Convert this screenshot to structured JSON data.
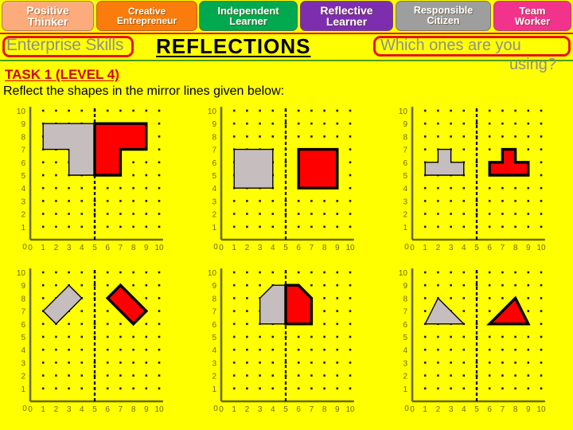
{
  "header": {
    "tabs": [
      {
        "id": "positive-thinker",
        "line1": "Positive",
        "line2": "Thinker",
        "color": "#FCAB7C"
      },
      {
        "id": "creative-entrepreneur",
        "line1": "Creative",
        "line2": "Entrepreneur",
        "color": "#F97C0C"
      },
      {
        "id": "independent-learner",
        "line1": "Independent",
        "line2": "Learner",
        "color": "#00A94F"
      },
      {
        "id": "reflective-learner",
        "line1": "Reflective",
        "line2": "Learner",
        "color": "#7D2EAF"
      },
      {
        "id": "responsible-citizen",
        "line1": "Responsible",
        "line2": "Citizen",
        "color": "#9E9E9E"
      },
      {
        "id": "team-worker",
        "line1": "Team",
        "line2": "Worker",
        "color": "#F2338C"
      }
    ]
  },
  "title": {
    "enterprise_skills": "Enterprise Skills",
    "main": "REFLECTIONS",
    "prompt_line1": "Which ones are you",
    "prompt_line2": "using?"
  },
  "task": {
    "heading": "TASK 1 (LEVEL 4)",
    "instruction": "Reflect the shapes in the mirror lines given below:"
  },
  "colors": {
    "page_background": "#FFFF00",
    "shape_original": "#C6BEBE",
    "shape_reflection": "#FF0000",
    "axis": "#6B6B00",
    "mirror_line": "#000000",
    "title_red": "#E81313",
    "rule_green": "#4E9A06"
  },
  "grid_common": {
    "x_ticks": [
      "0",
      "1",
      "2",
      "3",
      "4",
      "5",
      "6",
      "7",
      "8",
      "9",
      "10"
    ],
    "y_ticks": [
      "0",
      "1",
      "2",
      "3",
      "4",
      "5",
      "6",
      "7",
      "8",
      "9",
      "10"
    ],
    "x_range": [
      0,
      10
    ],
    "y_range": [
      0,
      10
    ],
    "mirror_line_x": 5,
    "dots": true
  },
  "chart_data": [
    {
      "type": "scatter",
      "id": "grid-1",
      "title": "",
      "xlabel": "",
      "ylabel": "",
      "xlim": [
        0,
        10
      ],
      "ylim": [
        0,
        10
      ],
      "mirror_x": 5,
      "shapes": [
        {
          "name": "original-L-shape",
          "fill": "#C6BEBE",
          "points": [
            [
              1,
              9
            ],
            [
              5,
              9
            ],
            [
              5,
              5
            ],
            [
              3,
              5
            ],
            [
              3,
              7
            ],
            [
              1,
              7
            ]
          ]
        },
        {
          "name": "reflected-L-shape",
          "fill": "#FF0000",
          "points": [
            [
              9,
              9
            ],
            [
              5,
              9
            ],
            [
              5,
              5
            ],
            [
              7,
              5
            ],
            [
              7,
              7
            ],
            [
              9,
              7
            ]
          ]
        }
      ]
    },
    {
      "type": "scatter",
      "id": "grid-2",
      "title": "",
      "xlabel": "",
      "ylabel": "",
      "xlim": [
        0,
        10
      ],
      "ylim": [
        0,
        10
      ],
      "mirror_x": 5,
      "shapes": [
        {
          "name": "original-square",
          "fill": "#C6BEBE",
          "points": [
            [
              1,
              4
            ],
            [
              4,
              4
            ],
            [
              4,
              7
            ],
            [
              1,
              7
            ]
          ]
        },
        {
          "name": "reflected-square",
          "fill": "#FF0000",
          "points": [
            [
              9,
              4
            ],
            [
              6,
              4
            ],
            [
              6,
              7
            ],
            [
              9,
              7
            ]
          ]
        }
      ]
    },
    {
      "type": "scatter",
      "id": "grid-3",
      "title": "",
      "xlabel": "",
      "ylabel": "",
      "xlim": [
        0,
        10
      ],
      "ylim": [
        0,
        10
      ],
      "mirror_x": 5,
      "shapes": [
        {
          "name": "original-T-shape",
          "fill": "#C6BEBE",
          "points": [
            [
              1,
              5
            ],
            [
              4,
              5
            ],
            [
              4,
              6
            ],
            [
              3,
              6
            ],
            [
              3,
              7
            ],
            [
              2,
              7
            ],
            [
              2,
              6
            ],
            [
              1,
              6
            ]
          ]
        },
        {
          "name": "reflected-T-shape",
          "fill": "#FF0000",
          "points": [
            [
              9,
              5
            ],
            [
              6,
              5
            ],
            [
              6,
              6
            ],
            [
              7,
              6
            ],
            [
              7,
              7
            ],
            [
              8,
              7
            ],
            [
              8,
              6
            ],
            [
              9,
              6
            ]
          ]
        }
      ]
    },
    {
      "type": "scatter",
      "id": "grid-4",
      "title": "",
      "xlabel": "",
      "ylabel": "",
      "xlim": [
        0,
        10
      ],
      "ylim": [
        0,
        10
      ],
      "mirror_x": 5,
      "shapes": [
        {
          "name": "original-rotated-rectangle",
          "fill": "#C6BEBE",
          "points": [
            [
              1,
              7
            ],
            [
              3,
              9
            ],
            [
              4,
              8
            ],
            [
              2,
              6
            ]
          ]
        },
        {
          "name": "reflected-rotated-rectangle",
          "fill": "#FF0000",
          "points": [
            [
              9,
              7
            ],
            [
              7,
              9
            ],
            [
              6,
              8
            ],
            [
              8,
              6
            ]
          ]
        }
      ]
    },
    {
      "type": "scatter",
      "id": "grid-5",
      "title": "",
      "xlabel": "",
      "ylabel": "",
      "xlim": [
        0,
        10
      ],
      "ylim": [
        0,
        10
      ],
      "mirror_x": 5,
      "shapes": [
        {
          "name": "original-pentagon",
          "fill": "#C6BEBE",
          "points": [
            [
              3,
              6
            ],
            [
              5,
              6
            ],
            [
              5,
              9
            ],
            [
              4,
              9
            ],
            [
              3,
              8
            ]
          ]
        },
        {
          "name": "reflected-pentagon",
          "fill": "#FF0000",
          "points": [
            [
              7,
              6
            ],
            [
              5,
              6
            ],
            [
              5,
              9
            ],
            [
              6,
              9
            ],
            [
              7,
              8
            ]
          ]
        }
      ]
    },
    {
      "type": "scatter",
      "id": "grid-6",
      "title": "",
      "xlabel": "",
      "ylabel": "",
      "xlim": [
        0,
        10
      ],
      "ylim": [
        0,
        10
      ],
      "mirror_x": 5,
      "shapes": [
        {
          "name": "original-triangle",
          "fill": "#C6BEBE",
          "points": [
            [
              1,
              6
            ],
            [
              4,
              6
            ],
            [
              2,
              8
            ]
          ]
        },
        {
          "name": "reflected-triangle",
          "fill": "#FF0000",
          "points": [
            [
              9,
              6
            ],
            [
              6,
              6
            ],
            [
              8,
              8
            ]
          ]
        }
      ]
    }
  ]
}
